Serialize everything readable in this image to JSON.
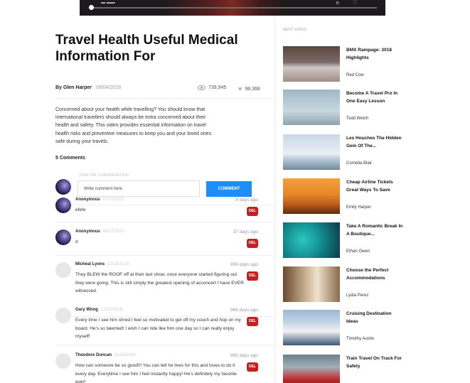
{
  "article": {
    "title": "Travel Health Useful Medical Information For",
    "author": "By Glen Harper",
    "date": "09/04/2018",
    "views": "739,945",
    "likes": "98,368",
    "description": "Concerned about your health while travelling? You should know that international travellers should always be extra concerned about their health and safety. This video provides essential information on travel health risks and preventive measures to keep you and your loved ones safe during your travels."
  },
  "comments_section": {
    "count_label": "5 Comments",
    "join_label": "JOIN THE CONVERSATION",
    "input_placeholder": "Write comment here",
    "submit_label": "COMMENT"
  },
  "comments": [
    {
      "name": "Anonymous",
      "date": "07/21/2021",
      "ago": "4 days ago",
      "text": "efefe",
      "del": "DEL"
    },
    {
      "name": "Anonymous",
      "date": "06/27/2021",
      "ago": "37 days ago",
      "text": "d",
      "del": "DEL"
    },
    {
      "name": "Micheal Lyons",
      "date": "12/18/2018",
      "ago": "959 days ago",
      "text": "They BLEW the ROOF off at their last show, once everyone started figuring out they were going. This is still simply the greatest opening of acconcert I have EVER witnessed.",
      "del": "DEL"
    },
    {
      "name": "Gary Wong",
      "date": "12/12/2018",
      "ago": "966 days ago",
      "text": "Every time I see him shred I feel so motivated to get off my couch and hop on my board. He's so talented! I wish I can ride like him one day so I can really enjoy myself!",
      "del": "DEL"
    },
    {
      "name": "Theodore Duncan",
      "date": "11/15/2018",
      "ago": "993 days ago",
      "text": "How can someone be so good!!! You can tell he lives for this and loves to do it every day. Everytime I see him I feel instantly happy! He's definitely my favorite ever!",
      "del": "DEL"
    }
  ],
  "sidebar": {
    "heading": "NEXT VIDEO",
    "items": [
      {
        "title": "BMX Rampage: 2018 Highlights",
        "author": "Red Cow"
      },
      {
        "title": "Become A Travel Pro In One Easy Lesson",
        "author": "Todd Welch"
      },
      {
        "title": "Les Houches The Hidden Gem Of The...",
        "author": "Cornelia Blair"
      },
      {
        "title": "Cheap Airline Tickets Great Ways To Save",
        "author": "Emily Harper"
      },
      {
        "title": "Take A Romantic Break In A Boutique...",
        "author": "Ethan Owen"
      },
      {
        "title": "Choose the Perfect Accommodations",
        "author": "Lydia Perez"
      },
      {
        "title": "Cruising Destination Ideas",
        "author": "Timothy Austin"
      },
      {
        "title": "Train Travel On Track For Safety",
        "author": ""
      }
    ]
  }
}
